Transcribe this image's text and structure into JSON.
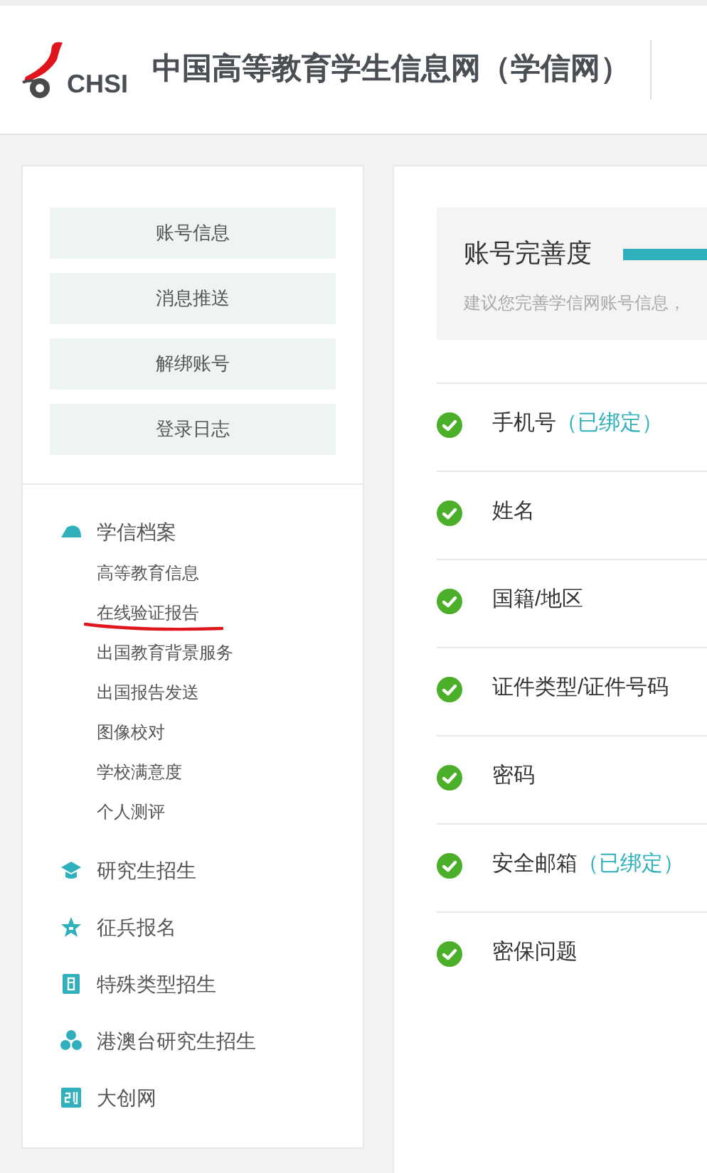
{
  "header": {
    "logo_text": "CHSI",
    "site_title": "中国高等教育学生信息网（学信网）"
  },
  "sidebar": {
    "buttons": [
      "账号信息",
      "消息推送",
      "解绑账号",
      "登录日志"
    ],
    "nav": [
      {
        "label": "学信档案",
        "children": [
          {
            "label": "高等教育信息",
            "marked": false
          },
          {
            "label": "在线验证报告",
            "marked": true
          },
          {
            "label": "出国教育背景服务",
            "marked": false
          },
          {
            "label": "出国报告发送",
            "marked": false
          },
          {
            "label": "图像校对",
            "marked": false
          },
          {
            "label": "学校满意度",
            "marked": false
          },
          {
            "label": "个人测评",
            "marked": false
          }
        ]
      },
      {
        "label": "研究生招生"
      },
      {
        "label": "征兵报名"
      },
      {
        "label": "特殊类型招生"
      },
      {
        "label": "港澳台研究生招生"
      },
      {
        "label": "大创网"
      }
    ]
  },
  "completeness": {
    "title": "账号完善度",
    "level": 1,
    "hint": "建议您完善学信网账号信息，"
  },
  "items": [
    {
      "label": "手机号",
      "status": "（已绑定）",
      "complete": true
    },
    {
      "label": "姓名",
      "complete": true
    },
    {
      "label": "国籍/地区",
      "complete": true
    },
    {
      "label": "证件类型/证件号码",
      "complete": true
    },
    {
      "label": "密码",
      "complete": true
    },
    {
      "label": "安全邮箱",
      "status": "（已绑定）",
      "complete": true
    },
    {
      "label": "密保问题",
      "complete": true
    }
  ]
}
